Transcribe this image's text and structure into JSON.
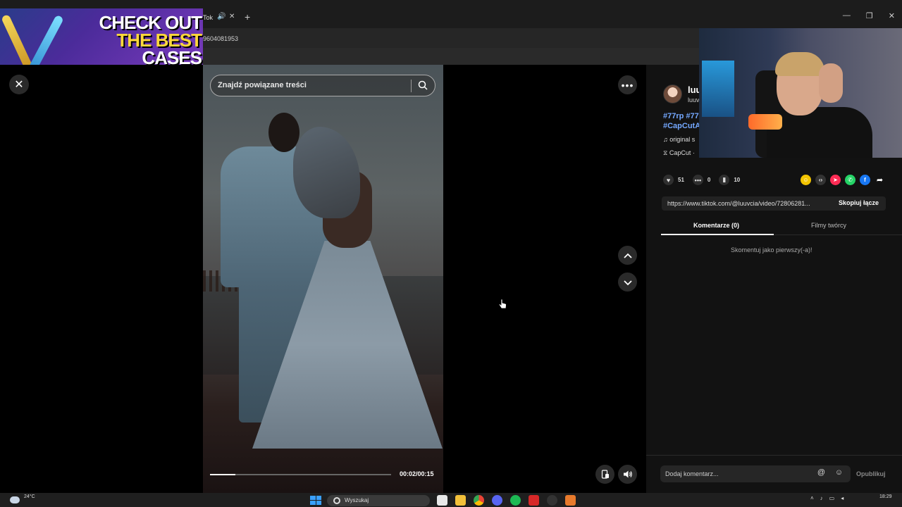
{
  "browser": {
    "tab_title": "Tok",
    "address_fragment": "9604081953"
  },
  "ad": {
    "line1": "CHECK OUT",
    "line2": "THE BEST",
    "line3": "CASES"
  },
  "search": {
    "placeholder": "Znajdź powiązane treści"
  },
  "player": {
    "current_time": "00:02/00:15",
    "progress": 0.14
  },
  "video_info": {
    "username": "luu",
    "handle": "luuv",
    "hashtags": "#77rp #77 #CapCutA",
    "music": "original s",
    "capcut": "CapCut ·"
  },
  "stats": {
    "likes": "51",
    "comments": "0",
    "saves": "10"
  },
  "link": {
    "url": "https://www.tiktok.com/@luuvcia/video/72806281...",
    "copy_label": "Skopiuj łącze"
  },
  "tabs": {
    "comments": "Komentarze (0)",
    "creator_videos": "Filmy twórcy"
  },
  "comments": {
    "empty_text": "Skomentuj jako pierwszy(-a)!",
    "input_placeholder": "Dodaj komentarz...",
    "publish_label": "Opublikuj"
  },
  "taskbar": {
    "temperature": "24°C",
    "search_label": "Wyszukaj",
    "time": "18:29"
  },
  "colors": {
    "hashtag": "#74a8ff",
    "accent": "#fe2c55"
  }
}
